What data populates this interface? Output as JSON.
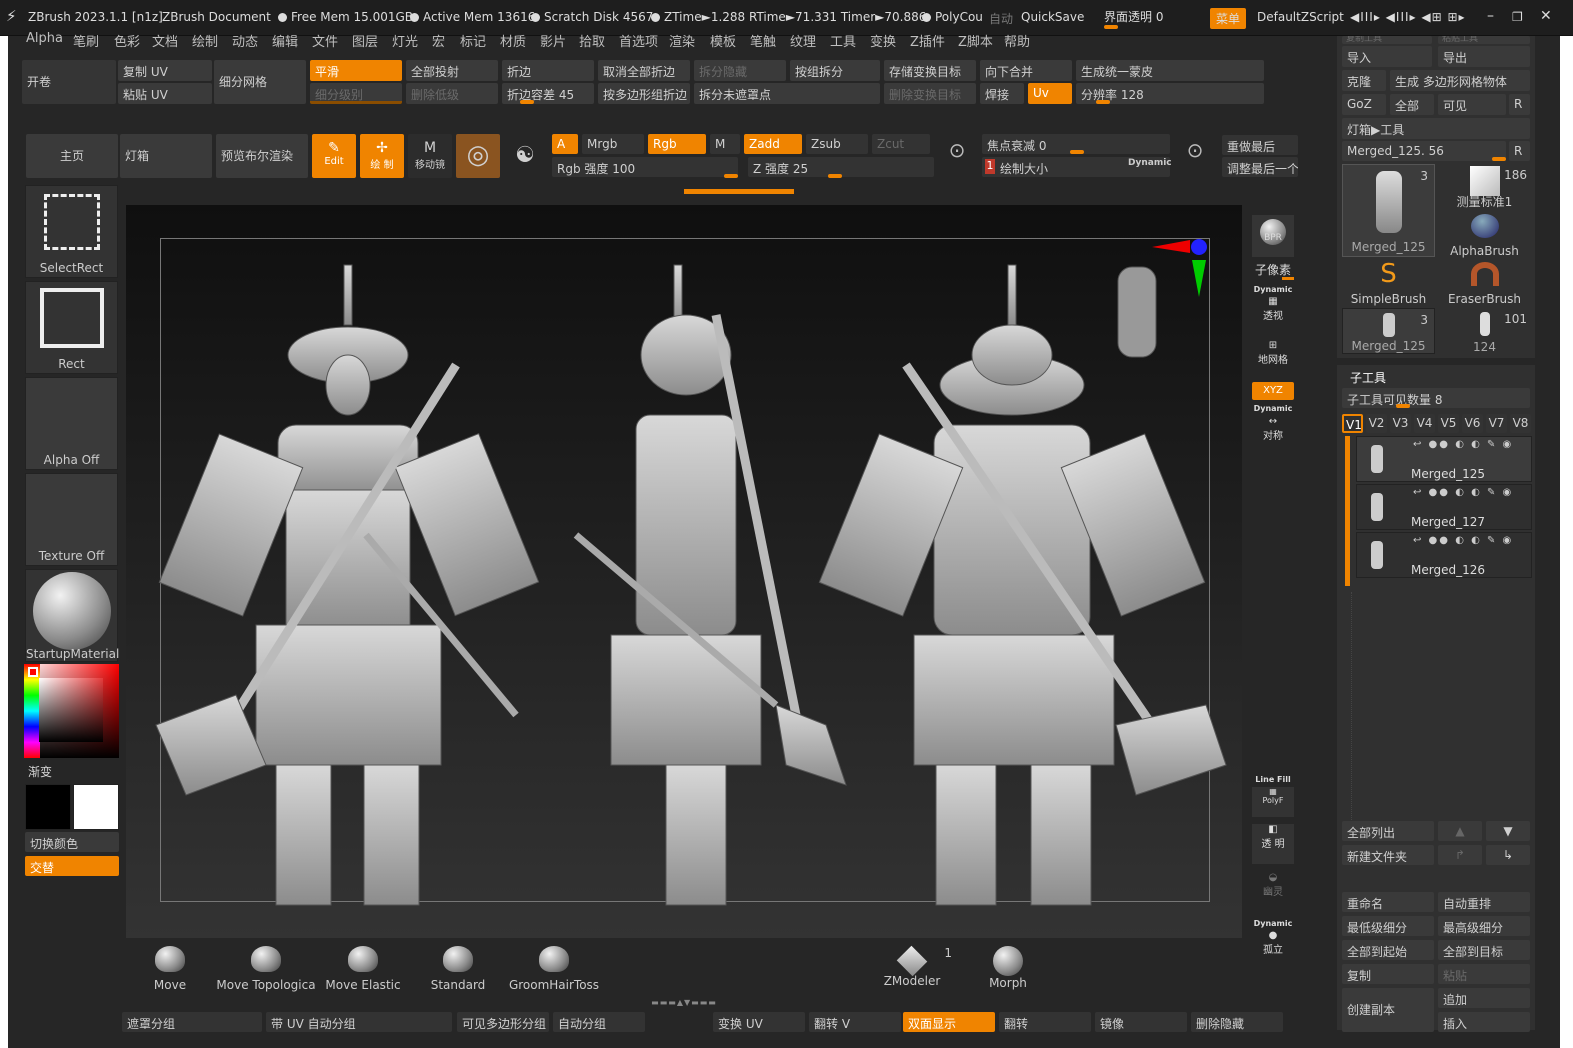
{
  "titlebar": {
    "app": "ZBrush 2023.1.1 [n1z]",
    "doc": "ZBrush Document",
    "free_mem": "Free Mem 15.001GB",
    "active_mem": "Active Mem 13616",
    "scratch": "Scratch Disk 4567",
    "ztime": "ZTime►1.288 RTime►71.331 Timer►70.886",
    "polycount": "PolyCou",
    "auto": "自动",
    "quicksave": "QuickSave",
    "transparency": "界面透明 0",
    "menu_btn": "菜单",
    "zscript": "DefaultZScript"
  },
  "menus": [
    "Alpha",
    "笔刷",
    "色彩",
    "文档",
    "绘制",
    "动态",
    "编辑",
    "文件",
    "图层",
    "灯光",
    "宏",
    "标记",
    "材质",
    "影片",
    "拾取",
    "首选项",
    "渲染",
    "模板",
    "笔触",
    "纹理",
    "工具",
    "变换",
    "Z插件",
    "Z脚本",
    "帮助"
  ],
  "top_tools": {
    "open": "开卷",
    "copy_uv": "复制 UV",
    "paste_uv": "粘贴 UV",
    "subdivide": "细分网格",
    "smooth": "平滑",
    "subdiv_level": "细分级别",
    "project_all": "全部投射",
    "del_lower": "删除低级",
    "crease": "折边",
    "crease_tol": "折边容差 45",
    "uncrease_all": "取消全部折边",
    "crease_poly": "按多边形组折边",
    "split_hidden": "拆分隐藏",
    "split_unmasked": "拆分未遮罩点",
    "group_split": "按组拆分",
    "store_morph": "存储变换目标",
    "del_morph": "删除变换目标",
    "merge_down": "向下合并",
    "weld": "焊接",
    "uv": "Uv",
    "unified_skin": "生成统一蒙皮",
    "resolution": "分辨率 128"
  },
  "shelf_top": {
    "home": "主页",
    "lightbox": "灯箱",
    "bpr": "预览布尔渲染",
    "edit": "Edit",
    "draw": "绘 制",
    "move": "移动镜",
    "a": "A",
    "mrgb": "Mrgb",
    "rgb": "Rgb",
    "m": "M",
    "zadd": "Zadd",
    "zsub": "Zsub",
    "zcut": "Zcut",
    "rgb_intensity": "Rgb 强度 100",
    "z_intensity": "Z 强度 25",
    "focal": "焦点衰减 0",
    "draw_size": "绘制大小",
    "draw_size_val": "1",
    "dynamic": "Dynamic",
    "redo_last": "重做最后",
    "adjust_last": "调整最后一个"
  },
  "left_panel": {
    "select_rect": "SelectRect",
    "rect": "Rect",
    "alpha_off": "Alpha Off",
    "texture_off": "Texture Off",
    "material": "StartupMaterial",
    "gradient": "渐变",
    "switch_color": "切换颜色",
    "alternate": "交替",
    "main_color": "#f5f5f5",
    "secondary_color": "#000000"
  },
  "right_icons": {
    "bpr": "BPR",
    "subpixel": "子像素",
    "dynamic": "Dynamic",
    "persp": "透视",
    "floor": "地网格",
    "xyz": "XYZ",
    "sym": "对称",
    "linefill": "Line Fill",
    "polyf": "PolyF",
    "transp": "透 明",
    "ghost": "幽灵",
    "solo": "孤立"
  },
  "tool_panel": {
    "copy_tool": "复制工具",
    "paste_tool": "粘贴工具",
    "import": "导入",
    "export": "导出",
    "clone": "克隆",
    "make_polymesh": "生成 多边形网格物体",
    "goz": "GoZ",
    "all": "全部",
    "visible": "可见",
    "r": "R",
    "lightbox_tool": "灯箱▶工具",
    "current": "Merged_125. 56",
    "thumbs": [
      {
        "name": "Merged_125",
        "count": "3"
      },
      {
        "name": "测量标准1",
        "count": "186"
      },
      {
        "name": "AlphaBrush",
        "count": ""
      },
      {
        "name": "SimpleBrush",
        "count": ""
      },
      {
        "name": "EraserBrush",
        "count": ""
      },
      {
        "name": "Merged_125",
        "count": "3"
      },
      {
        "name": "124",
        "count": "101"
      }
    ],
    "subtool_title": "子工具",
    "subtool_visible": "子工具可见数量 8",
    "versions": [
      "V1",
      "V2",
      "V3",
      "V4",
      "V5",
      "V6",
      "V7",
      "V8"
    ],
    "subtools": [
      "Merged_125",
      "Merged_127",
      "Merged_126"
    ],
    "list_all": "全部列出",
    "new_folder": "新建文件夹",
    "rename": "重命名",
    "auto_reorder": "自动重排",
    "lowest": "最低级细分",
    "highest": "最高级细分",
    "all_to_start": "全部到起始",
    "all_to_target": "全部到目标",
    "copy": "复制",
    "paste": "粘贴",
    "duplicate": "创建副本",
    "append": "追加",
    "insert": "插入"
  },
  "brushes": [
    "Move",
    "Move Topologica",
    "Move Elastic",
    "Standard",
    "GroomHairToss"
  ],
  "zmodeler": {
    "name": "ZModeler",
    "count": "1"
  },
  "morph": "Morph",
  "bottom_bar": [
    "遮罩分组",
    "带 UV 自动分组",
    "可见多边形分组",
    "自动分组",
    "变换 UV",
    "翻转 V",
    "双面显示",
    "翻转",
    "镜像",
    "删除隐藏"
  ],
  "slider_levels": {
    "rgb_intensity": 100,
    "z_intensity": 25,
    "focal": 0,
    "crease_tol": 45,
    "resolution": 128
  }
}
